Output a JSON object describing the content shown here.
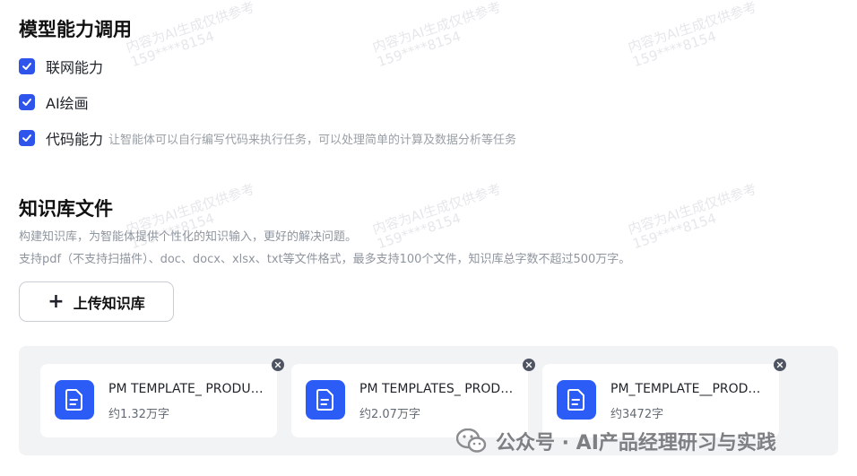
{
  "capabilities": {
    "title": "模型能力调用",
    "items": [
      {
        "label": "联网能力",
        "checked": true,
        "desc": ""
      },
      {
        "label": "AI绘画",
        "checked": true,
        "desc": ""
      },
      {
        "label": "代码能力",
        "checked": true,
        "desc": "让智能体可以自行编写代码来执行任务，可以处理简单的计算及数据分析等任务"
      }
    ]
  },
  "knowledge": {
    "title": "知识库文件",
    "desc1": "构建知识库，为智能体提供个性化的知识输入，更好的解决问题。",
    "desc2": "支持pdf（不支持扫描件）、doc、docx、xlsx、txt等文件格式，最多支持100个文件，知识库总字数不超过500万字。",
    "upload_icon": "+",
    "upload_label": "上传知识库",
    "files": [
      {
        "name": "PM TEMPLATE_ PRODUCT",
        "size": "约1.32万字",
        "icon": "document-icon"
      },
      {
        "name": "PM TEMPLATES_ PRODUCT",
        "size": "约2.07万字",
        "icon": "document-icon"
      },
      {
        "name": "PM_TEMPLATE__PRODUCT",
        "size": "约3472字",
        "icon": "document-icon"
      }
    ]
  },
  "footer": {
    "icon": "wechat-icon",
    "text": "公众号 · AI产品经理研习与实践"
  },
  "watermark": {
    "line1": "内容为AI生成仅供参考",
    "line2": "159****8154"
  },
  "colors": {
    "accent": "#2f54eb",
    "file_icon_bg": "#2b5cf6",
    "panel_bg": "#f2f3f5"
  }
}
